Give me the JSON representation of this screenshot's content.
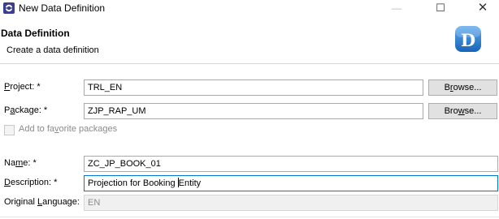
{
  "window": {
    "title": "New Data Definition",
    "minimize_glyph": "—",
    "maximize_glyph": "☐",
    "close_glyph": "✕",
    "app_icon": "eclipse-icon"
  },
  "header": {
    "title": "Data Definition",
    "description": "Create a data definition",
    "logo_letter": "D",
    "logo_color": "#1a73c7"
  },
  "form": {
    "project": {
      "label_ul": "P",
      "label_rest": "roject: *",
      "value": "TRL_EN"
    },
    "package": {
      "label_pre": "P",
      "label_ul": "a",
      "label_rest": "ckage: *",
      "value": "ZJP_RAP_UM"
    },
    "browse_project": {
      "pre": "B",
      "ul": "r",
      "rest": "owse..."
    },
    "browse_package": {
      "pre": "Bro",
      "ul": "w",
      "rest": "se..."
    },
    "favorites": {
      "pre": "Add to fa",
      "ul": "v",
      "rest": "orite packages",
      "checked": false
    },
    "name": {
      "label_pre": "Na",
      "label_ul": "m",
      "label_rest": "e: *",
      "value": "ZC_JP_BOOK_01"
    },
    "description": {
      "label_ul": "D",
      "label_rest": "escription: *",
      "value_pre": "Projection for Booking ",
      "value_post": "Entity"
    },
    "original_language": {
      "label_pre": "Original ",
      "label_ul": "L",
      "label_rest": "anguage:",
      "value": "EN"
    }
  }
}
